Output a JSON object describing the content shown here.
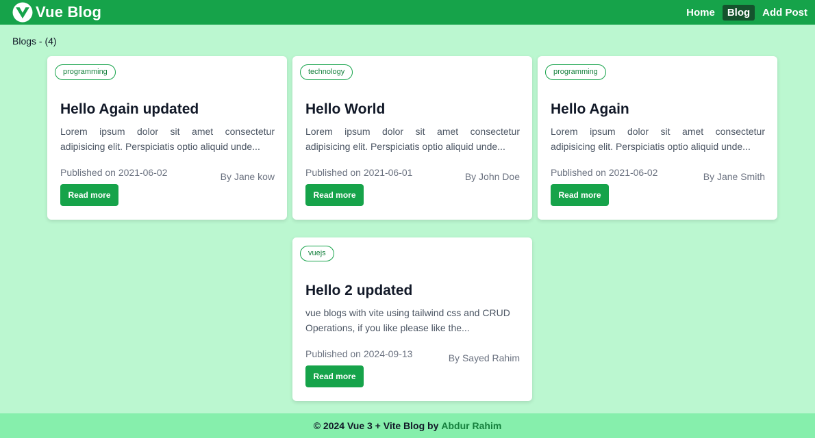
{
  "navbar": {
    "brand": "Vue Blog",
    "links": [
      {
        "label": "Home",
        "active": false
      },
      {
        "label": "Blog",
        "active": true
      },
      {
        "label": "Add Post",
        "active": false
      }
    ]
  },
  "page": {
    "blogs_count": "Blogs - (4)"
  },
  "posts": [
    {
      "tag": "programming",
      "title": "Hello Again updated",
      "excerpt": "Lorem ipsum dolor sit amet consectetur adipisicing elit. Perspiciatis optio aliquid unde...",
      "published": "Published on 2021-06-02",
      "author": "By Jane kow",
      "read_more": "Read more"
    },
    {
      "tag": "technology",
      "title": "Hello World",
      "excerpt": "Lorem ipsum dolor sit amet consectetur adipisicing elit. Perspiciatis optio aliquid unde...",
      "published": "Published on 2021-06-01",
      "author": "By John Doe",
      "read_more": "Read more"
    },
    {
      "tag": "programming",
      "title": "Hello Again",
      "excerpt": "Lorem ipsum dolor sit amet consectetur adipisicing elit. Perspiciatis optio aliquid unde...",
      "published": "Published on 2021-06-02",
      "author": "By Jane Smith",
      "read_more": "Read more"
    },
    {
      "tag": "vuejs",
      "title": "Hello 2 updated",
      "excerpt": "vue blogs with vite using tailwind css and CRUD Operations, if you like please like the...",
      "published": "Published on 2024-09-13",
      "author": "By Sayed Rahim",
      "read_more": "Read more"
    }
  ],
  "footer": {
    "text": "© 2024 Vue 3 + Vite Blog by",
    "author": "Abdur Rahim"
  },
  "colors": {
    "primary": "#16a34a",
    "page_bg": "#bbf7d0",
    "footer_bg": "#86efac",
    "active_nav": "#14532d"
  }
}
